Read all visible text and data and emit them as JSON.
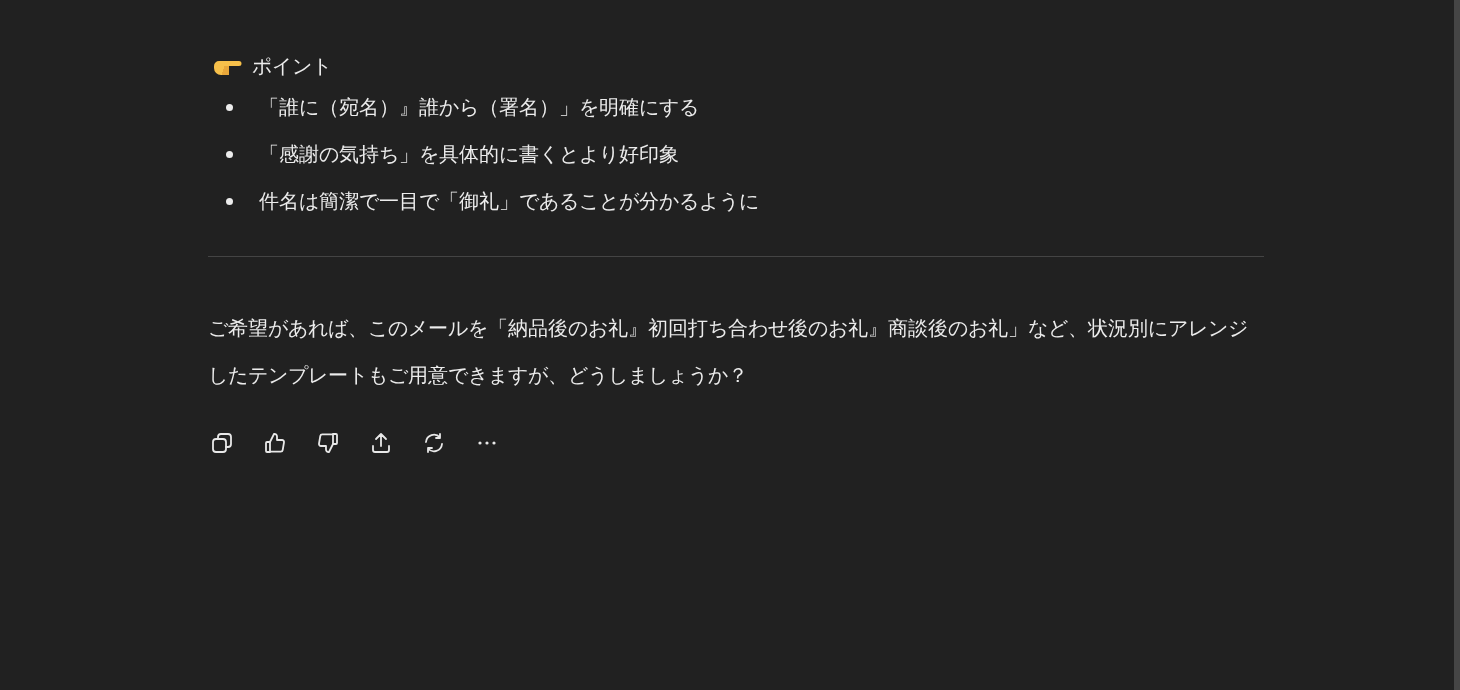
{
  "heading": {
    "text": "ポイント"
  },
  "points": [
    "「誰に（宛名）』誰から（署名）」を明確にする",
    "「感謝の気持ち」を具体的に書くとより好印象",
    "件名は簡潔で一目で「御礼」であることが分かるように"
  ],
  "paragraph": "ご希望があれば、このメールを「納品後のお礼』初回打ち合わせ後のお礼』商談後のお礼」など、状況別にアレンジしたテンプレートもご用意できますが、どうしましょうか？",
  "actions": [
    {
      "kind": "copy"
    },
    {
      "kind": "like"
    },
    {
      "kind": "dislike"
    },
    {
      "kind": "share"
    },
    {
      "kind": "regenerate"
    },
    {
      "kind": "more"
    }
  ]
}
